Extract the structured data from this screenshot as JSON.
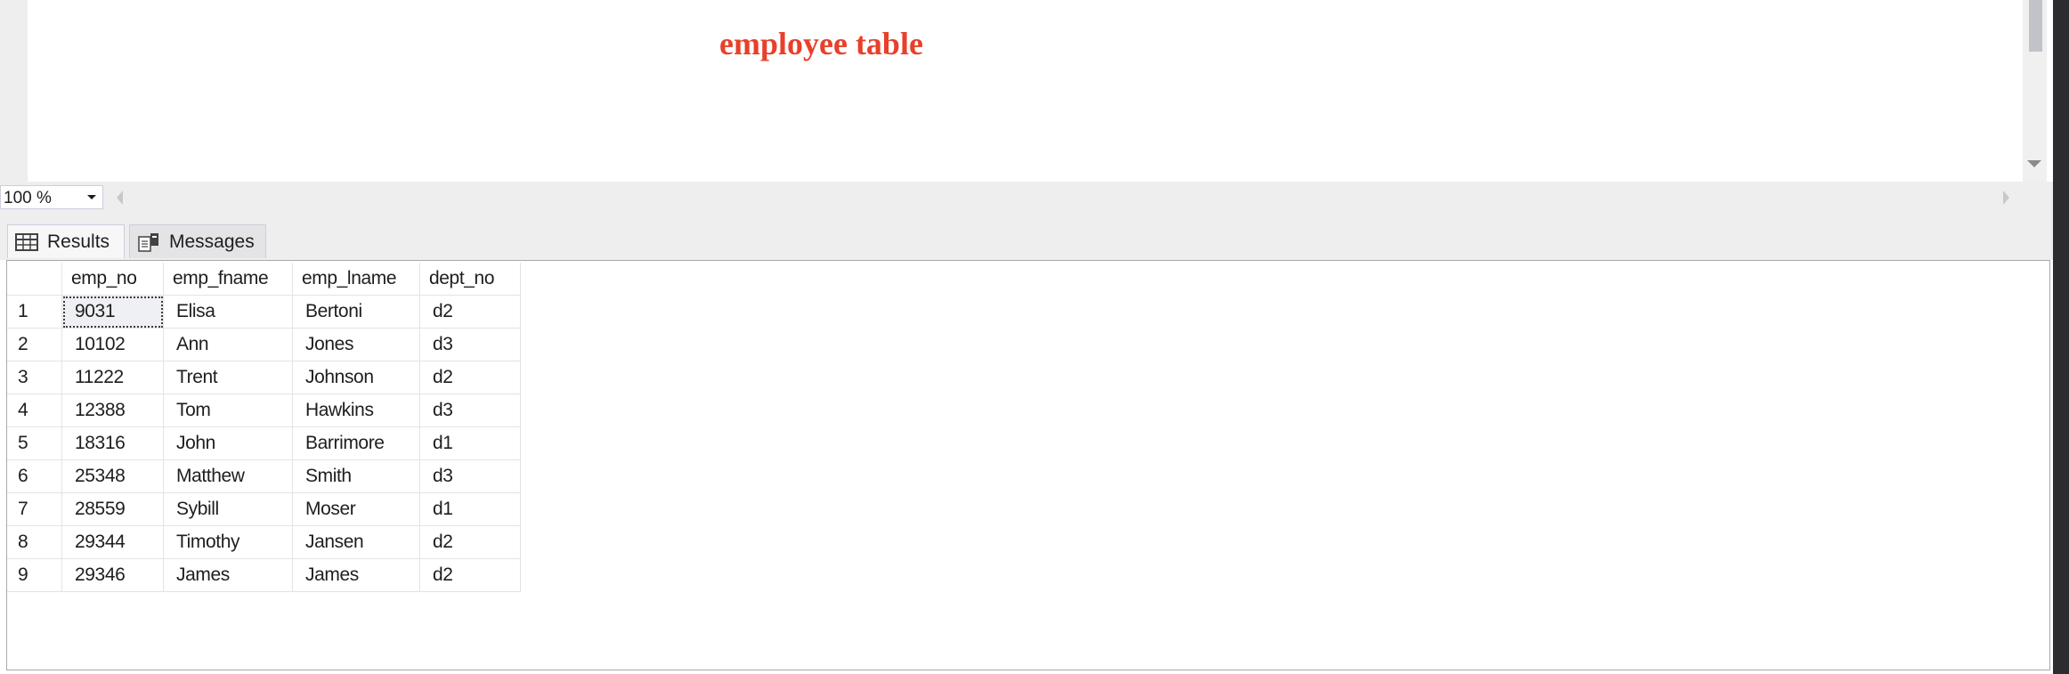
{
  "editor": {
    "title": "employee table"
  },
  "zoom": {
    "value": "100 %"
  },
  "tabs": [
    {
      "label": "Results",
      "icon": "grid-icon",
      "active": true
    },
    {
      "label": "Messages",
      "icon": "messages-icon",
      "active": false
    }
  ],
  "colors": {
    "title": "#e8402a",
    "panel": "#eeeeef",
    "grid_border": "#e3e3e3"
  },
  "grid": {
    "columns": [
      "emp_no",
      "emp_fname",
      "emp_lname",
      "dept_no"
    ],
    "rows": [
      {
        "n": "1",
        "cells": [
          "9031",
          "Elisa",
          "Bertoni",
          "d2"
        ]
      },
      {
        "n": "2",
        "cells": [
          "10102",
          "Ann",
          "Jones",
          "d3"
        ]
      },
      {
        "n": "3",
        "cells": [
          "11222",
          "Trent",
          "Johnson",
          "d2"
        ]
      },
      {
        "n": "4",
        "cells": [
          "12388",
          "Tom",
          "Hawkins",
          "d3"
        ]
      },
      {
        "n": "5",
        "cells": [
          "18316",
          "John",
          "Barrimore",
          "d1"
        ]
      },
      {
        "n": "6",
        "cells": [
          "25348",
          "Matthew",
          "Smith",
          "d3"
        ]
      },
      {
        "n": "7",
        "cells": [
          "28559",
          "Sybill",
          "Moser",
          "d1"
        ]
      },
      {
        "n": "8",
        "cells": [
          "29344",
          "Timothy",
          "Jansen",
          "d2"
        ]
      },
      {
        "n": "9",
        "cells": [
          "29346",
          "James",
          "James",
          "d2"
        ]
      }
    ]
  }
}
